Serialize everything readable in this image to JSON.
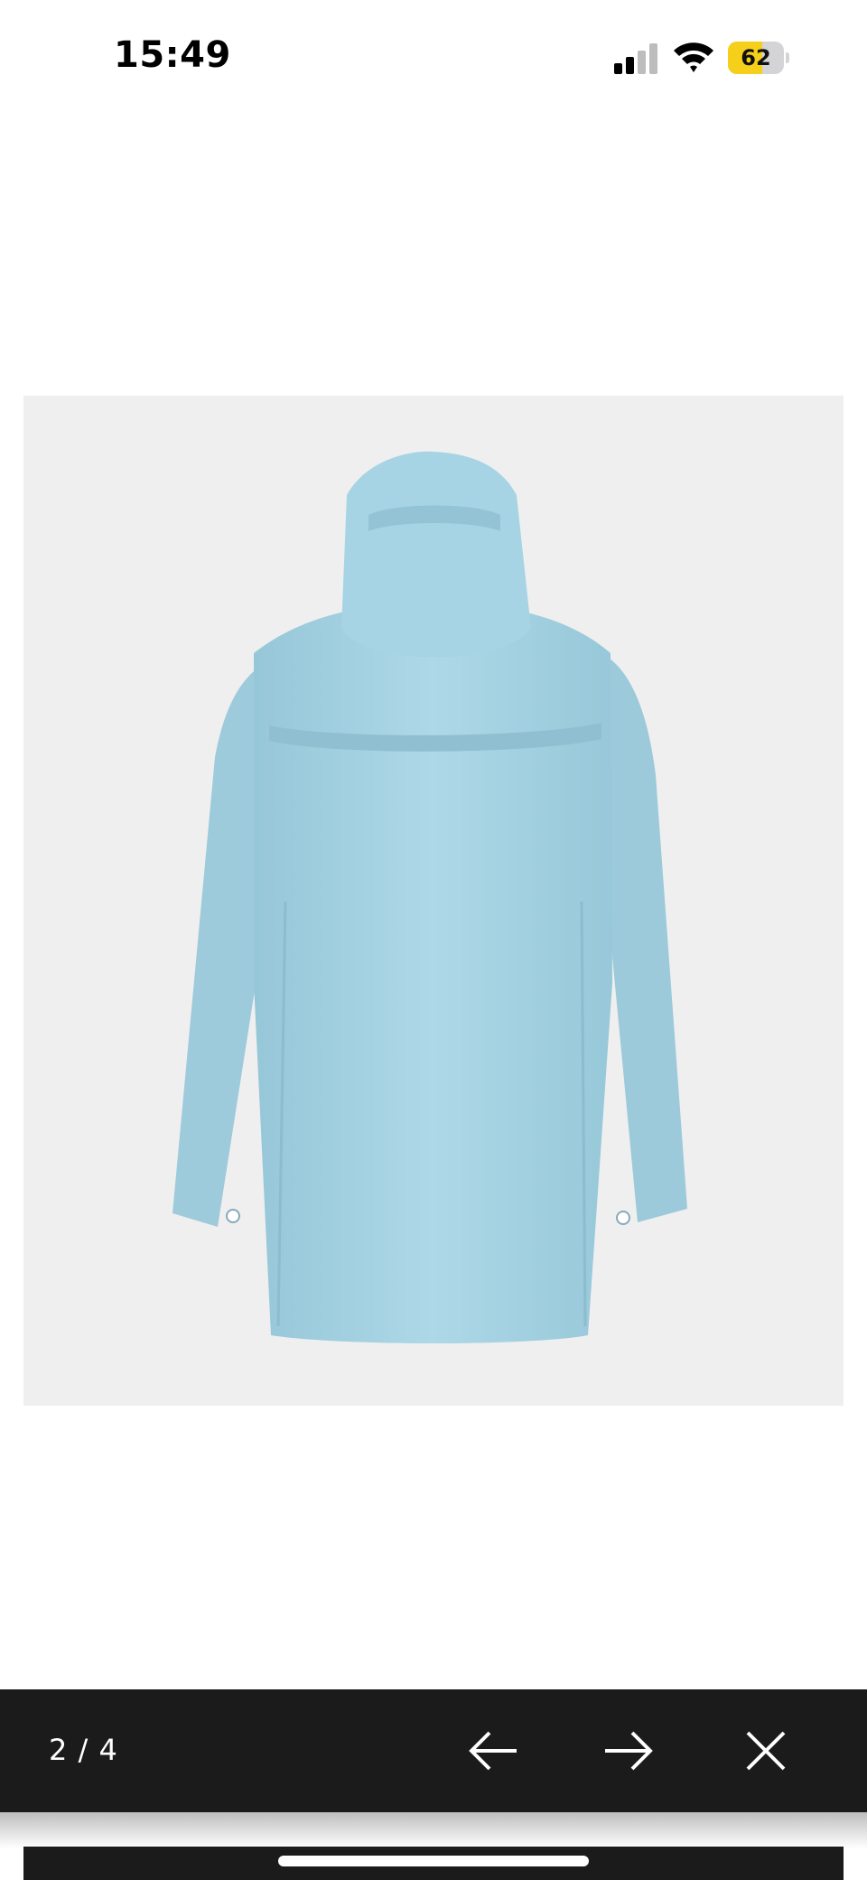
{
  "status_bar": {
    "time": "15:49",
    "battery_level": "62",
    "battery_fraction": 0.62,
    "battery_color": "#f5cf1a",
    "icons": [
      "signal-icon",
      "wifi-icon",
      "battery-icon"
    ]
  },
  "product_image": {
    "background_color": "#efefef",
    "garment_color": "#a9d6e5",
    "icon": "raincoat-back-view"
  },
  "viewer": {
    "counter": "2 / 4",
    "icons": [
      "arrow-left-icon",
      "arrow-right-icon",
      "close-icon"
    ]
  }
}
